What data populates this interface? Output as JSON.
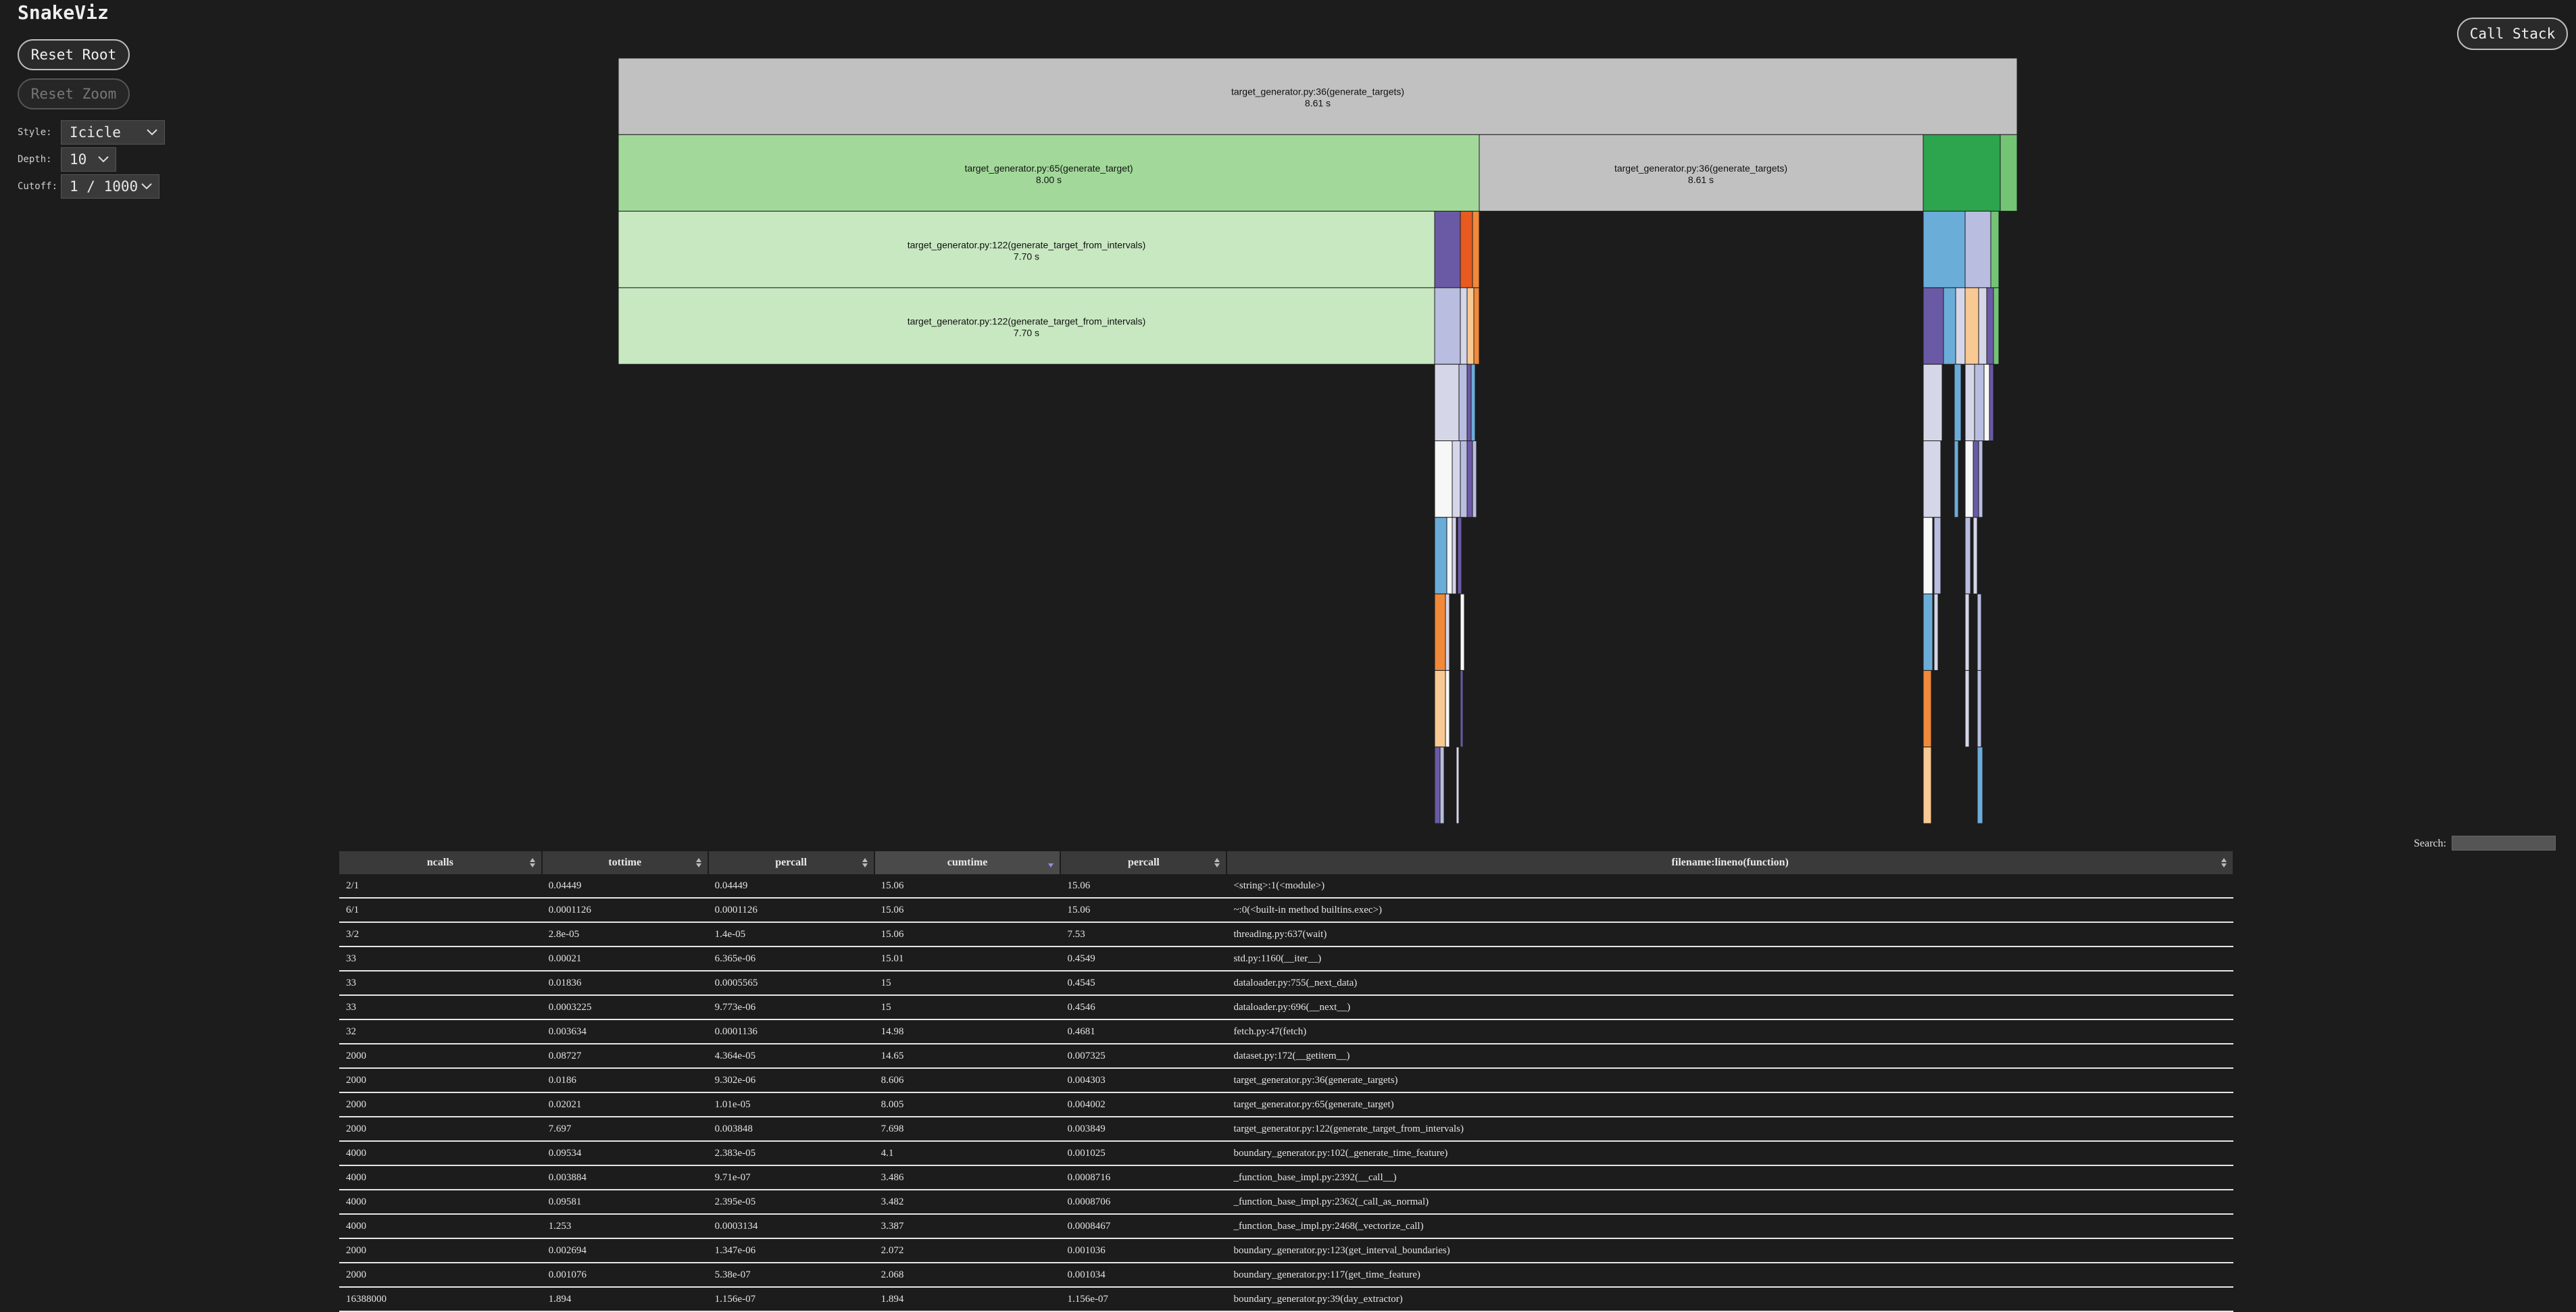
{
  "app": {
    "title": "SnakeViz"
  },
  "controls": {
    "reset_root": "Reset Root",
    "reset_zoom": "Reset Zoom",
    "call_stack": "Call Stack",
    "style_label": "Style:",
    "style_value": "Icicle",
    "depth_label": "Depth:",
    "depth_value": "10",
    "cutoff_label": "Cutoff:",
    "cutoff_value": "1 / 1000"
  },
  "icicle": {
    "total_seconds": 8.61,
    "labeled_blocks": [
      {
        "label": "target_generator.py:36(generate_targets)",
        "time": "8.61 s",
        "color": "#c1c1c1"
      },
      {
        "label": "target_generator.py:65(generate_target)",
        "time": "8.00 s",
        "color": "#a2d99a"
      },
      {
        "label": "target_generator.py:36(generate_targets)",
        "time": "8.61 s",
        "color": "#c1c1c1"
      },
      {
        "label": "target_generator.py:122(generate_target_from_intervals)",
        "time": "7.70 s",
        "color": "#c8e8c1"
      },
      {
        "label": "target_generator.py:122(generate_target_from_intervals)",
        "time": "7.70 s",
        "color": "#c8e8c1"
      }
    ],
    "palette": [
      "#6a5aa6",
      "#e85a1f",
      "#f08a3a",
      "#6badd9",
      "#b9bde0",
      "#f9c994",
      "#d6d6e9",
      "#2da44e",
      "#74c476",
      "#f7f7f7"
    ]
  },
  "search": {
    "label": "Search:",
    "value": ""
  },
  "table": {
    "columns": [
      "ncalls",
      "tottime",
      "percall",
      "cumtime",
      "percall",
      "filename:lineno(function)"
    ],
    "sorted_column": "cumtime",
    "rows": [
      [
        "2/1",
        "0.04449",
        "0.04449",
        "15.06",
        "15.06",
        "<string>:1(<module>)"
      ],
      [
        "6/1",
        "0.0001126",
        "0.0001126",
        "15.06",
        "15.06",
        "~:0(<built-in method builtins.exec>)"
      ],
      [
        "3/2",
        "2.8e-05",
        "1.4e-05",
        "15.06",
        "7.53",
        "threading.py:637(wait)"
      ],
      [
        "33",
        "0.00021",
        "6.365e-06",
        "15.01",
        "0.4549",
        "std.py:1160(__iter__)"
      ],
      [
        "33",
        "0.01836",
        "0.0005565",
        "15",
        "0.4545",
        "dataloader.py:755(_next_data)"
      ],
      [
        "33",
        "0.0003225",
        "9.773e-06",
        "15",
        "0.4546",
        "dataloader.py:696(__next__)"
      ],
      [
        "32",
        "0.003634",
        "0.0001136",
        "14.98",
        "0.4681",
        "fetch.py:47(fetch)"
      ],
      [
        "2000",
        "0.08727",
        "4.364e-05",
        "14.65",
        "0.007325",
        "dataset.py:172(__getitem__)"
      ],
      [
        "2000",
        "0.0186",
        "9.302e-06",
        "8.606",
        "0.004303",
        "target_generator.py:36(generate_targets)"
      ],
      [
        "2000",
        "0.02021",
        "1.01e-05",
        "8.005",
        "0.004002",
        "target_generator.py:65(generate_target)"
      ],
      [
        "2000",
        "7.697",
        "0.003848",
        "7.698",
        "0.003849",
        "target_generator.py:122(generate_target_from_intervals)"
      ],
      [
        "4000",
        "0.09534",
        "2.383e-05",
        "4.1",
        "0.001025",
        "boundary_generator.py:102(_generate_time_feature)"
      ],
      [
        "4000",
        "0.003884",
        "9.71e-07",
        "3.486",
        "0.0008716",
        "_function_base_impl.py:2392(__call__)"
      ],
      [
        "4000",
        "0.09581",
        "2.395e-05",
        "3.482",
        "0.0008706",
        "_function_base_impl.py:2362(_call_as_normal)"
      ],
      [
        "4000",
        "1.253",
        "0.0003134",
        "3.387",
        "0.0008467",
        "_function_base_impl.py:2468(_vectorize_call)"
      ],
      [
        "2000",
        "0.002694",
        "1.347e-06",
        "2.072",
        "0.001036",
        "boundary_generator.py:123(get_interval_boundaries)"
      ],
      [
        "2000",
        "0.001076",
        "5.38e-07",
        "2.068",
        "0.001034",
        "boundary_generator.py:117(get_time_feature)"
      ],
      [
        "16388000",
        "1.894",
        "1.156e-07",
        "1.894",
        "1.156e-07",
        "boundary_generator.py:39(day_extractor)"
      ]
    ]
  }
}
